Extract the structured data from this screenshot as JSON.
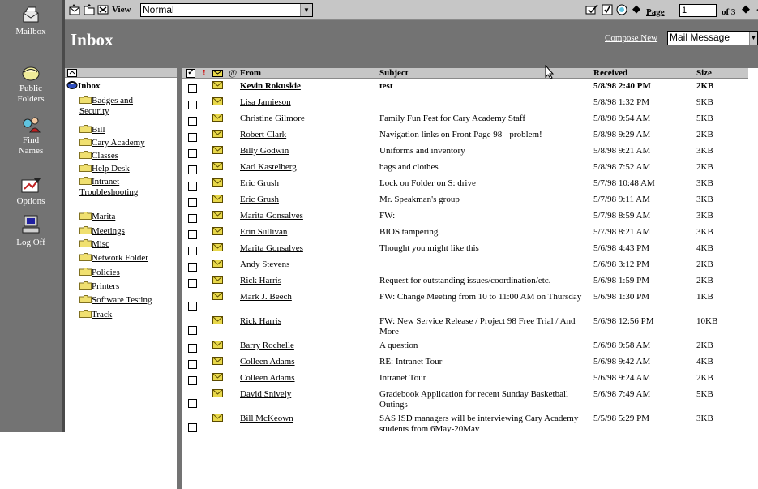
{
  "nav": {
    "items": [
      {
        "label": "Mailbox",
        "icon": "mailbox-icon"
      },
      {
        "label": "Public\nFolders",
        "label1": "Public",
        "label2": "Folders",
        "icon": "public-folders-icon"
      },
      {
        "label1": "Find",
        "label2": "Names",
        "icon": "find-names-icon"
      },
      {
        "label": "Options",
        "icon": "options-icon"
      },
      {
        "label": "Log Off",
        "icon": "log-off-icon"
      }
    ]
  },
  "toolbar": {
    "view_label": "View",
    "view_value": "Normal",
    "page_label": "Page",
    "page_value": "1",
    "page_total": "of 3",
    "compose_label": "Compose New",
    "compose_value": "Mail Message"
  },
  "title": "Inbox",
  "folders": {
    "root": "Inbox",
    "items": [
      "Badges and Security",
      "Bill",
      "Cary Academy",
      "Classes",
      "Help Desk",
      "Intranet Troubleshooting",
      "Marita",
      "Meetings",
      "Misc",
      "Network Folder",
      "Policies",
      "Printers",
      "Software Testing",
      "Track"
    ]
  },
  "list": {
    "headers": {
      "from": "From",
      "subject": "Subject",
      "received": "Received",
      "size": "Size",
      "importance": "!"
    },
    "rows": [
      {
        "from": "Kevin Rokuskie",
        "subject": "test",
        "received": "5/8/98 2:40 PM",
        "size": "2KB",
        "unread": true
      },
      {
        "from": "Lisa Jamieson",
        "subject": "",
        "received": "5/8/98 1:32 PM",
        "size": "9KB"
      },
      {
        "from": "Christine Gilmore",
        "subject": "Family Fun Fest for Cary Academy Staff",
        "received": "5/8/98 9:54 AM",
        "size": "5KB"
      },
      {
        "from": "Robert Clark",
        "subject": "Navigation links on Front Page 98 - problem!",
        "received": "5/8/98 9:29 AM",
        "size": "2KB"
      },
      {
        "from": "Billy Godwin",
        "subject": "Uniforms and inventory",
        "received": "5/8/98 9:21 AM",
        "size": "3KB"
      },
      {
        "from": "Karl Kastelberg",
        "subject": "bags and clothes",
        "received": "5/8/98 7:52 AM",
        "size": "2KB"
      },
      {
        "from": "Eric Grush",
        "subject": "Lock on Folder on S: drive",
        "received": "5/7/98 10:48 AM",
        "size": "3KB"
      },
      {
        "from": "Eric Grush",
        "subject": "Mr. Speakman's group",
        "received": "5/7/98 9:11 AM",
        "size": "3KB"
      },
      {
        "from": "Marita Gonsalves",
        "subject": "FW:",
        "received": "5/7/98 8:59 AM",
        "size": "3KB"
      },
      {
        "from": "Erin Sullivan",
        "subject": "BIOS tampering.",
        "received": "5/7/98 8:21 AM",
        "size": "3KB"
      },
      {
        "from": "Marita Gonsalves",
        "subject": "Thought you might like this",
        "received": "5/6/98 4:43 PM",
        "size": "4KB"
      },
      {
        "from": "Andy Stevens",
        "subject": "",
        "received": "5/6/98 3:12 PM",
        "size": "2KB"
      },
      {
        "from": "Rick Harris",
        "subject": "Request for outstanding issues/coordination/etc.",
        "received": "5/6/98 1:59 PM",
        "size": "2KB"
      },
      {
        "from": "Mark J. Beech",
        "subject": "FW: Change Meeting from 10 to 11:00 AM on Thursday",
        "received": "5/6/98 1:30 PM",
        "size": "1KB"
      },
      {
        "from": "Rick Harris",
        "subject": "FW: New Service Release / Project 98 Free Trial / And More",
        "received": "5/6/98 12:56 PM",
        "size": "10KB"
      },
      {
        "from": "Barry Rochelle",
        "subject": "A question",
        "received": "5/6/98 9:58 AM",
        "size": "2KB"
      },
      {
        "from": "Colleen Adams",
        "subject": "RE: Intranet Tour",
        "received": "5/6/98 9:42 AM",
        "size": "4KB"
      },
      {
        "from": "Colleen Adams",
        "subject": "Intranet Tour",
        "received": "5/6/98 9:24 AM",
        "size": "2KB"
      },
      {
        "from": "David Snively",
        "subject": "Gradebook Application for recent Sunday Basketball Outings",
        "received": "5/6/98 7:49 AM",
        "size": "5KB"
      },
      {
        "from": "Bill McKeown",
        "subject": "SAS ISD managers will be interviewing Cary Academy students from 6May-20May",
        "received": "5/5/98 5:29 PM",
        "size": "3KB"
      }
    ]
  },
  "colors": {
    "rail": "#737373",
    "toolbar": "#c6c6c6",
    "divider": "#4a4a4a",
    "envelope": "#e8d84a"
  }
}
